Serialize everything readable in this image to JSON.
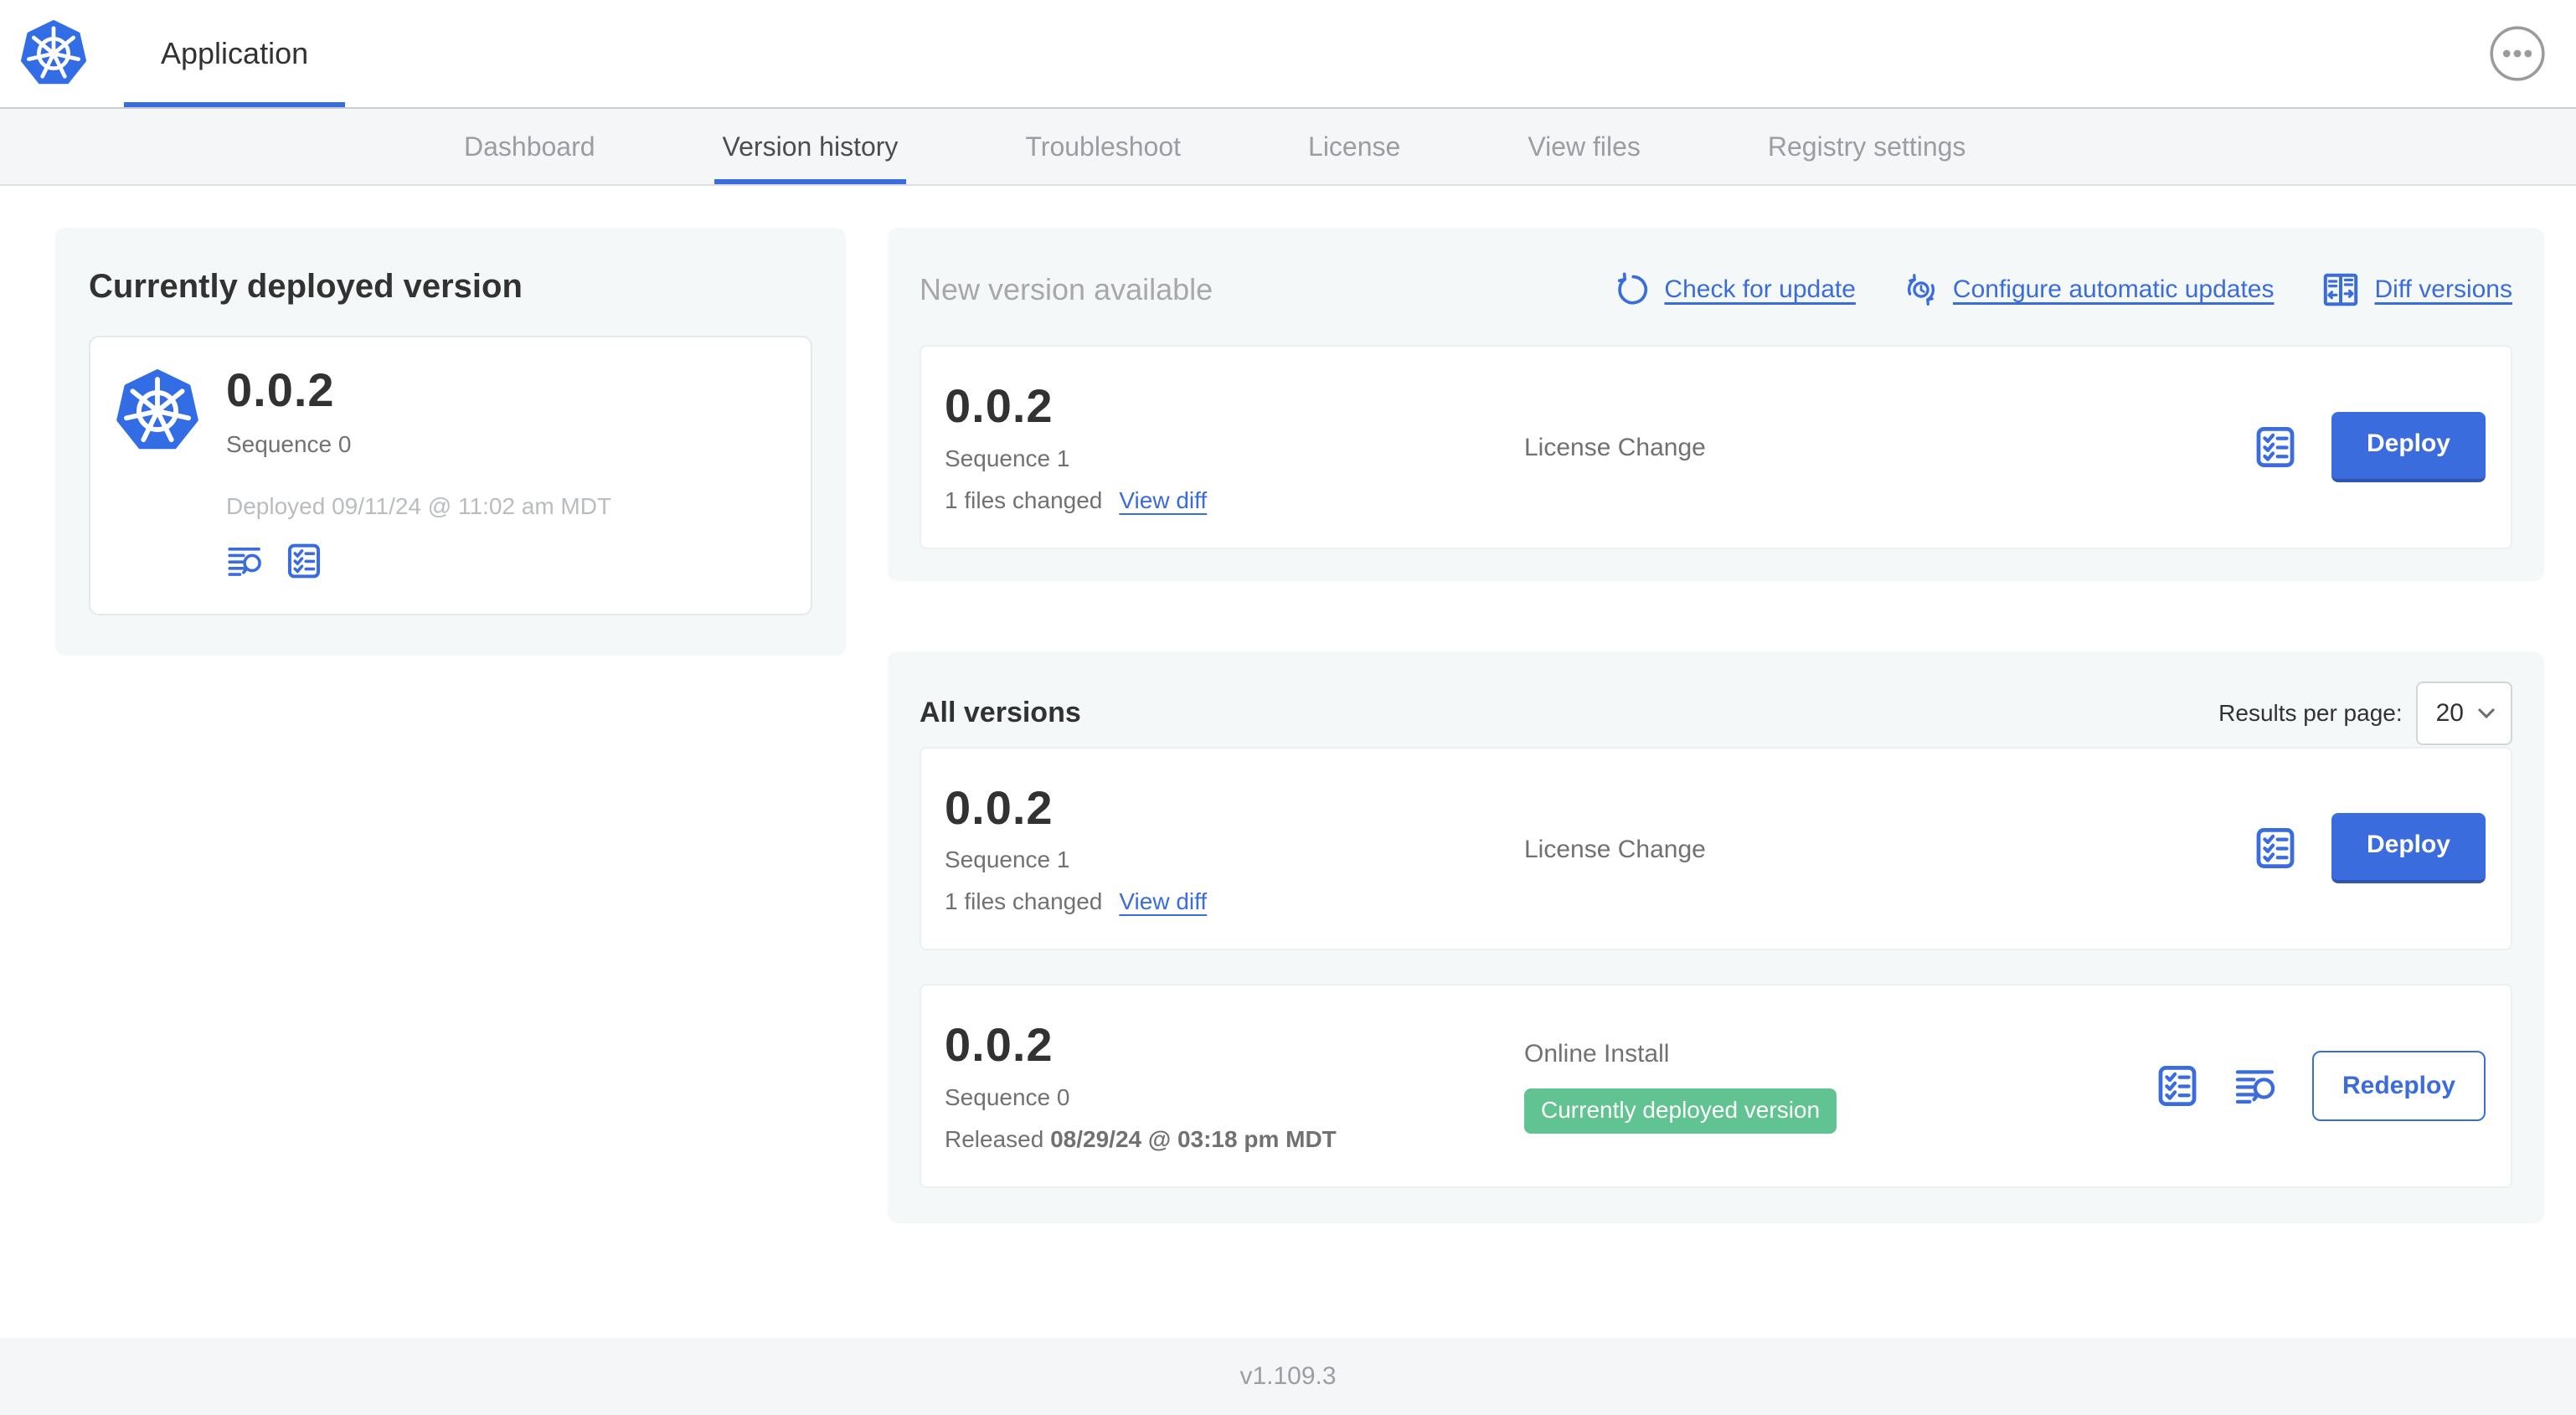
{
  "app": {
    "title": "Application"
  },
  "nav": {
    "tabs": [
      {
        "label": "Dashboard",
        "active": false
      },
      {
        "label": "Version history",
        "active": true
      },
      {
        "label": "Troubleshoot",
        "active": false
      },
      {
        "label": "License",
        "active": false
      },
      {
        "label": "View files",
        "active": false
      },
      {
        "label": "Registry settings",
        "active": false
      }
    ]
  },
  "current_version": {
    "heading": "Currently deployed version",
    "version": "0.0.2",
    "sequence": "Sequence 0",
    "deployed": "Deployed 09/11/24 @ 11:02 am MDT"
  },
  "new_version": {
    "heading": "New version available",
    "actions": [
      {
        "label": "Check for update"
      },
      {
        "label": "Configure automatic updates"
      },
      {
        "label": "Diff versions"
      }
    ],
    "card": {
      "version": "0.0.2",
      "sequence": "Sequence 1",
      "files_changed": "1 files changed",
      "view_diff": "View diff",
      "source": "License Change",
      "action": "Deploy"
    }
  },
  "all_versions": {
    "heading": "All versions",
    "results_per_page_label": "Results per page:",
    "results_per_page_value": "20",
    "rows": [
      {
        "version": "0.0.2",
        "sequence": "Sequence 1",
        "files_changed": "1 files changed",
        "view_diff": "View diff",
        "source": "License Change",
        "action": "Deploy"
      },
      {
        "version": "0.0.2",
        "sequence": "Sequence 0",
        "released_prefix": "Released",
        "released_date": "08/29/24 @ 03:18 pm MDT",
        "source": "Online Install",
        "badge": "Currently deployed version",
        "action": "Redeploy"
      }
    ]
  },
  "footer": {
    "version": "v1.109.3"
  },
  "icons": {
    "app_logo": "kubernetes-helm-wheel",
    "overflow_menu": "ellipsis-in-circle",
    "release_notes": "text-lines-with-magnifier",
    "preflight_checks": "checklist-in-rounded-square",
    "check_for_update": "counterclockwise-refresh-arrow",
    "configure_updates": "clock-with-sync-arrows",
    "diff_versions": "split-pane-with-arrows",
    "select_chevron": "chevron-down"
  },
  "colors": {
    "accent": "#3b6cde",
    "accentDark": "#2e55b2",
    "logoBlue": "#326de6",
    "badgeGreen": "#61c392",
    "textDark": "#323232",
    "textMid": "#717171",
    "textLight": "#a8a8a8",
    "textFaint": "#b9bdc0",
    "panelBg": "#f5f8f9"
  }
}
